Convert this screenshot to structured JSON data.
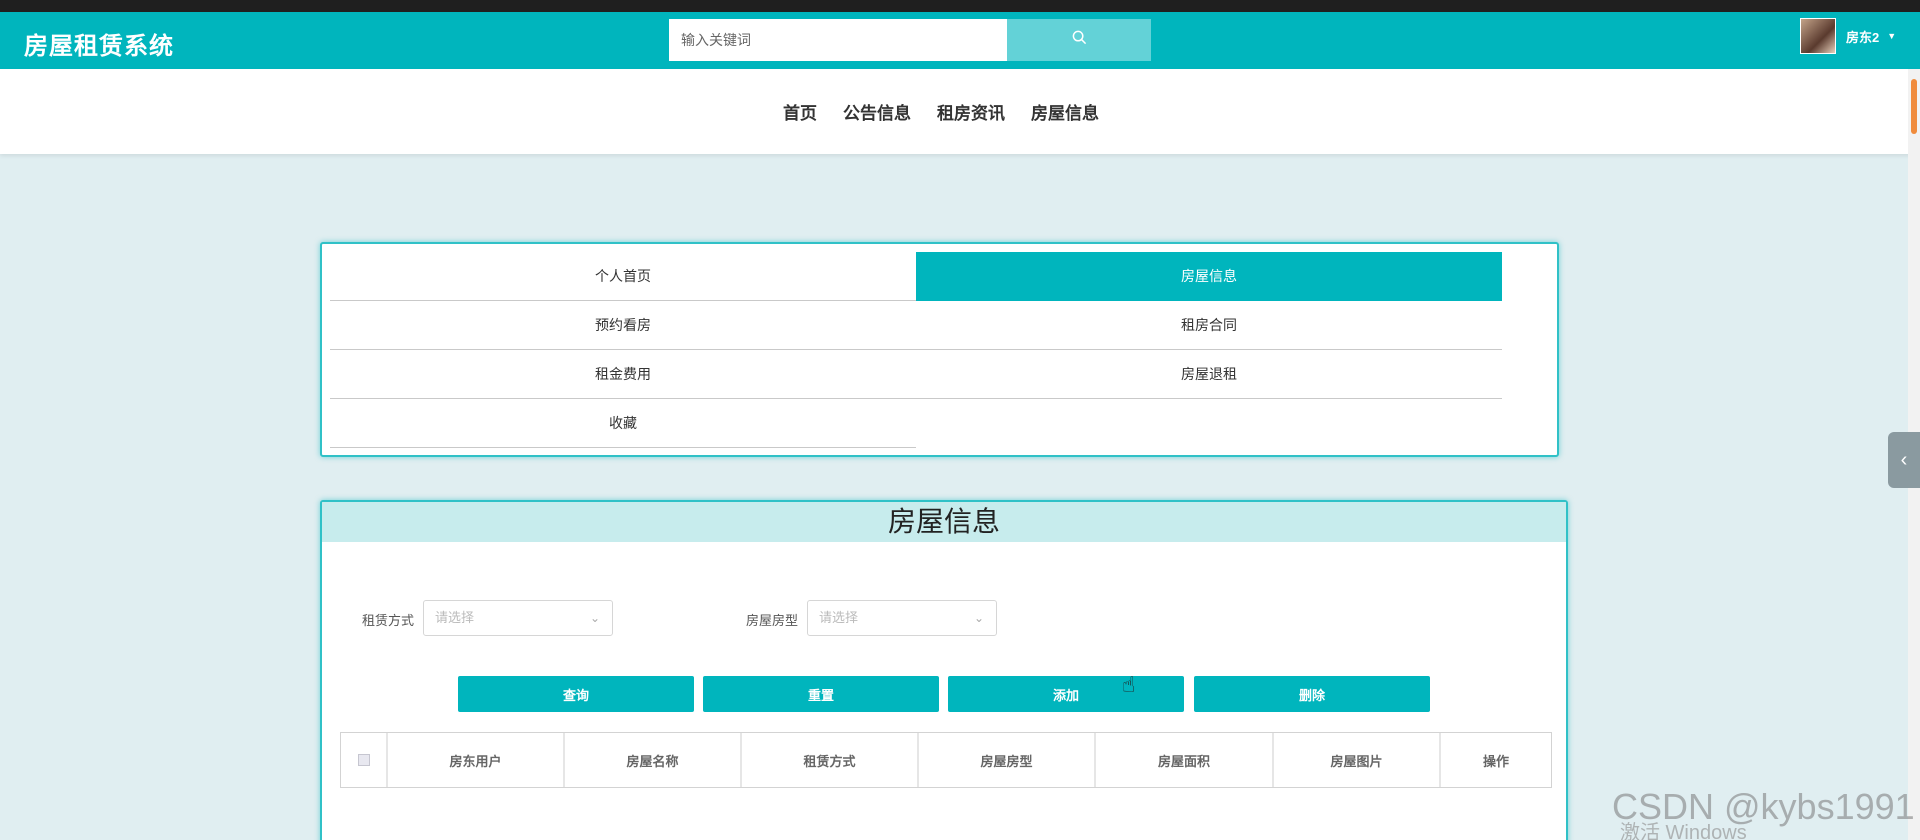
{
  "header": {
    "brand": "房屋租赁系统",
    "search_placeholder": "输入关键词",
    "search_icon": "search-icon",
    "user_name": "房东2"
  },
  "nav": {
    "items": [
      "首页",
      "公告信息",
      "租房资讯",
      "房屋信息"
    ]
  },
  "menu": {
    "items": [
      {
        "label": "个人首页",
        "active": false
      },
      {
        "label": "房屋信息",
        "active": true
      },
      {
        "label": "预约看房",
        "active": false
      },
      {
        "label": "租房合同",
        "active": false
      },
      {
        "label": "租金费用",
        "active": false
      },
      {
        "label": "房屋退租",
        "active": false
      },
      {
        "label": "收藏",
        "active": false
      }
    ]
  },
  "list": {
    "title": "房屋信息",
    "filters": [
      {
        "label": "租赁方式",
        "placeholder": "请选择"
      },
      {
        "label": "房屋房型",
        "placeholder": "请选择"
      }
    ],
    "buttons": [
      "查询",
      "重置",
      "添加",
      "删除"
    ],
    "columns": [
      "房东用户",
      "房屋名称",
      "租赁方式",
      "房屋房型",
      "房屋面积",
      "房屋图片",
      "操作"
    ]
  },
  "watermark": "CSDN @kybs1991",
  "os_notice": "激活 Windows",
  "colors": {
    "primary": "#00b5bd",
    "header_bg": "#00b5bd",
    "page_bg": "#e0eef1",
    "title_bar": "#c7eced"
  }
}
